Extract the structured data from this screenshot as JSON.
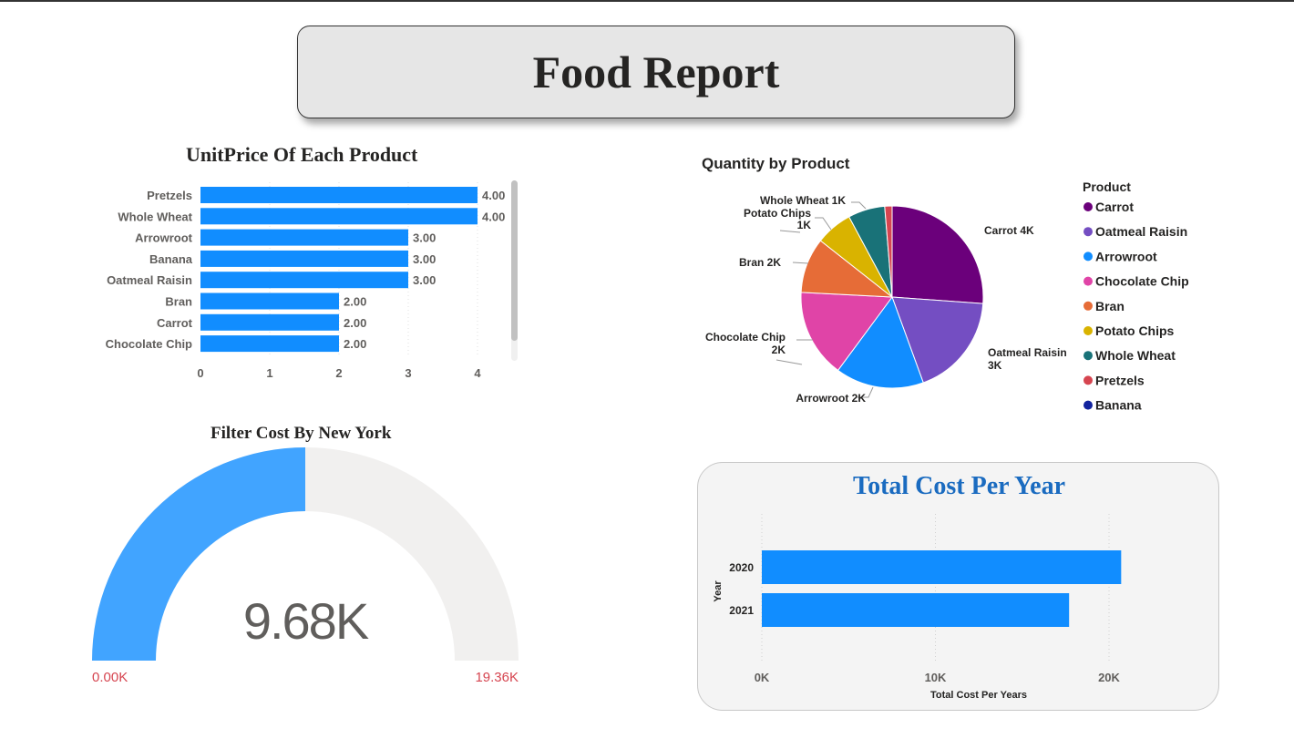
{
  "header": {
    "title": "Food Report"
  },
  "unit_price": {
    "title": "UnitPrice Of Each Product"
  },
  "quantity": {
    "title": "Quantity by Product",
    "legend_title": "Product"
  },
  "gauge": {
    "title": "Filter Cost By New York",
    "value_label": "9.68K",
    "min_label": "0.00K",
    "max_label": "19.36K"
  },
  "total_cost": {
    "title": "Total Cost Per Year",
    "xlabel": "Total Cost Per Years",
    "ylabel": "Year"
  },
  "colors": {
    "bar": "#118dff",
    "gauge_fill": "#41a4ff",
    "gauge_track": "#f1f0ef",
    "gauge_labels": "#d64550",
    "total_title": "#1a6bc0"
  },
  "chart_data": [
    {
      "id": "unitprice",
      "type": "bar",
      "orientation": "horizontal",
      "title": "UnitPrice Of Each Product",
      "categories": [
        "Pretzels",
        "Whole Wheat",
        "Arrowroot",
        "Banana",
        "Oatmeal Raisin",
        "Bran",
        "Carrot",
        "Chocolate Chip"
      ],
      "values": [
        4,
        4,
        3,
        3,
        3,
        2,
        2,
        2
      ],
      "data_labels": [
        "4.00",
        "4.00",
        "3.00",
        "3.00",
        "3.00",
        "2.00",
        "2.00",
        "2.00"
      ],
      "xticks": [
        "0",
        "1",
        "2",
        "3",
        "4"
      ],
      "xlim": [
        0,
        4
      ],
      "grid": true
    },
    {
      "id": "quantity",
      "type": "pie",
      "title": "Quantity by Product",
      "legend_title": "Product",
      "legend_position": "right",
      "slices": [
        {
          "label": "Carrot",
          "value": 4000,
          "data_label": "Carrot 4K",
          "color": "#6b007b"
        },
        {
          "label": "Oatmeal Raisin",
          "value": 2800,
          "data_label": "Oatmeal Raisin 3K",
          "color": "#744ec2"
        },
        {
          "label": "Arrowroot",
          "value": 2400,
          "data_label": "Arrowroot 2K",
          "color": "#118dff"
        },
        {
          "label": "Chocolate Chip",
          "value": 2400,
          "data_label": "Chocolate Chip 2K",
          "color": "#e044a7"
        },
        {
          "label": "Bran",
          "value": 1500,
          "data_label": "Bran 2K",
          "color": "#e66c37"
        },
        {
          "label": "Potato Chips",
          "value": 1000,
          "data_label": "Potato Chips 1K",
          "color": "#d9b300"
        },
        {
          "label": "Whole Wheat",
          "value": 1000,
          "data_label": "Whole Wheat 1K",
          "color": "#197278"
        },
        {
          "label": "Pretzels",
          "value": 200,
          "data_label": "",
          "color": "#d64550"
        },
        {
          "label": "Banana",
          "value": 0,
          "data_label": "",
          "color": "#12239e"
        }
      ]
    },
    {
      "id": "gauge",
      "type": "gauge",
      "title": "Filter Cost By New York",
      "value": 9680,
      "min": 0,
      "max": 19360,
      "value_label": "9.68K",
      "min_label": "0.00K",
      "max_label": "19.36K"
    },
    {
      "id": "totalcost",
      "type": "bar",
      "orientation": "horizontal",
      "title": "Total Cost Per Year",
      "categories": [
        "2020",
        "2021"
      ],
      "values": [
        20700,
        17700
      ],
      "xticks": [
        {
          "value": 0,
          "label": "0K"
        },
        {
          "value": 10000,
          "label": "10K"
        },
        {
          "value": 20000,
          "label": "20K"
        }
      ],
      "xlim": [
        0,
        22000
      ],
      "xlabel": "Total Cost Per Years",
      "ylabel": "Year",
      "grid": true
    }
  ]
}
